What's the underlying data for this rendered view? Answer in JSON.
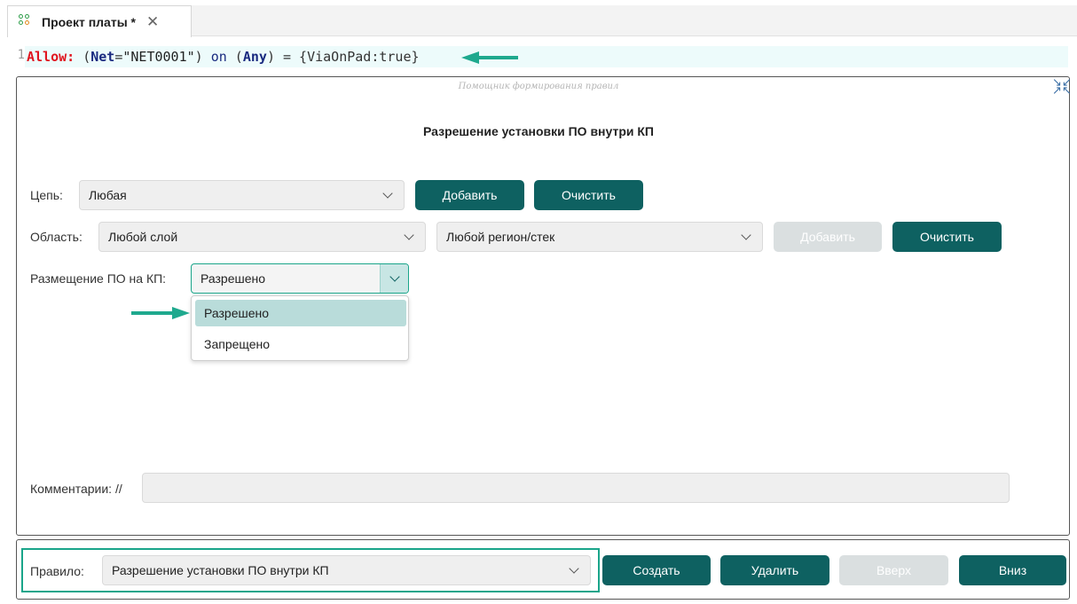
{
  "tab": {
    "title": "Проект платы *",
    "close": "✕",
    "icon": "pcb-project-icon"
  },
  "editor": {
    "line_number": "1",
    "code": {
      "allow": "Allow:",
      "p1": " (",
      "net_kw": "Net",
      "eq": "=",
      "net_val": "\"NET0001\"",
      "p2": ") ",
      "on": "on",
      "p3": " (",
      "any": "Any",
      "p4": ") = {ViaOnPad:true}"
    }
  },
  "builder": {
    "hint": "Помощник формирования правил",
    "title": "Разрешение установки ПО внутри КП",
    "net": {
      "label": "Цепь:",
      "value": "Любая",
      "add_label": "Добавить",
      "clear_label": "Очистить"
    },
    "area": {
      "label": "Область:",
      "layer_value": "Любой слой",
      "region_value": "Любой регион/стек",
      "add_label": "Добавить",
      "clear_label": "Очистить"
    },
    "placement": {
      "label": "Размещение ПО на КП:",
      "value": "Разрешено",
      "options": [
        "Разрешено",
        "Запрещено"
      ]
    },
    "comment": {
      "label": "Комментарии: //",
      "value": ""
    }
  },
  "footer": {
    "rule_label": "Правило:",
    "rule_value": "Разрешение установки ПО внутри КП",
    "create_label": "Создать",
    "delete_label": "Удалить",
    "up_label": "Вверх",
    "down_label": "Вниз"
  },
  "colors": {
    "accent": "#0e6161",
    "annotation_arrow": "#1fa98e",
    "highlight_border": "#1aa58a",
    "keyword_red": "#e0141e",
    "keyword_navy": "#1a2a80"
  }
}
